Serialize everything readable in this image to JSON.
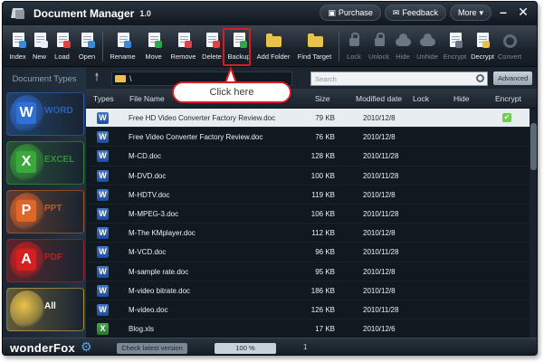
{
  "window": {
    "title": "Document Manager",
    "version": "1.0"
  },
  "title_buttons": {
    "purchase": "Purchase",
    "feedback": "Feedback",
    "more": "More"
  },
  "toolbar": [
    {
      "key": "index",
      "label": "Index",
      "icon": "index-icon",
      "enabled": true
    },
    {
      "key": "new",
      "label": "New",
      "icon": "new-document-icon",
      "enabled": true
    },
    {
      "key": "load",
      "label": "Load",
      "icon": "load-icon",
      "enabled": true
    },
    {
      "key": "open",
      "label": "Open",
      "icon": "open-icon",
      "enabled": true
    },
    {
      "key": "rename",
      "label": "Rename",
      "icon": "rename-icon",
      "enabled": true
    },
    {
      "key": "move",
      "label": "Move",
      "icon": "move-icon",
      "enabled": true
    },
    {
      "key": "remove",
      "label": "Remove",
      "icon": "remove-icon",
      "enabled": true
    },
    {
      "key": "delete",
      "label": "Delete",
      "icon": "delete-icon",
      "enabled": true
    },
    {
      "key": "backup",
      "label": "Backup",
      "icon": "backup-icon",
      "enabled": true
    },
    {
      "key": "add_folder",
      "label": "Add Folder",
      "icon": "add-folder-icon",
      "enabled": true
    },
    {
      "key": "find_target",
      "label": "Find Target",
      "icon": "find-target-icon",
      "enabled": true
    },
    {
      "key": "lock",
      "label": "Lock",
      "icon": "lock-icon",
      "enabled": false
    },
    {
      "key": "unlock",
      "label": "Unlock",
      "icon": "unlock-icon",
      "enabled": false
    },
    {
      "key": "hide",
      "label": "Hide",
      "icon": "hide-icon",
      "enabled": false
    },
    {
      "key": "unhide",
      "label": "Unhide",
      "icon": "unhide-icon",
      "enabled": false
    },
    {
      "key": "encrypt",
      "label": "Encrypt",
      "icon": "encrypt-icon",
      "enabled": false
    },
    {
      "key": "decrypt",
      "label": "Decrypt",
      "icon": "decrypt-icon",
      "enabled": true
    },
    {
      "key": "convert",
      "label": "Convert",
      "icon": "convert-icon",
      "enabled": false
    }
  ],
  "sidebar": {
    "title": "Document Types",
    "categories": [
      {
        "label": "WORD",
        "letter": "W",
        "color": "#2f6fd6"
      },
      {
        "label": "EXCEL",
        "letter": "X",
        "color": "#3aa83a"
      },
      {
        "label": "PPT",
        "letter": "P",
        "color": "#e0662a"
      },
      {
        "label": "PDF",
        "letter": "A",
        "color": "#d42020"
      },
      {
        "label": "All",
        "letter": "",
        "color": "#e8c24a"
      }
    ]
  },
  "pathbar": {
    "path": "\\",
    "search_placeholder": "Search",
    "advanced_label": "Advanced"
  },
  "columns": {
    "types": "Types",
    "file_name": "File Name",
    "size": "Size",
    "modified": "Modified date",
    "lock": "Lock",
    "hide": "Hide",
    "encrypt": "Encrypt"
  },
  "files": [
    {
      "type": "doc",
      "name": "Free HD Video Converter Factory Review.doc",
      "size": "79 KB",
      "modified": "2010/12/8",
      "encrypted": true,
      "selected": true
    },
    {
      "type": "doc",
      "name": "Free Video Converter Factory Review.doc",
      "size": "76 KB",
      "modified": "2010/12/8",
      "encrypted": false,
      "selected": false
    },
    {
      "type": "doc",
      "name": "M-CD.doc",
      "size": "128 KB",
      "modified": "2010/11/28",
      "encrypted": false,
      "selected": false
    },
    {
      "type": "doc",
      "name": "M-DVD.doc",
      "size": "100 KB",
      "modified": "2010/11/28",
      "encrypted": false,
      "selected": false
    },
    {
      "type": "doc",
      "name": "M-HDTV.doc",
      "size": "119 KB",
      "modified": "2010/12/8",
      "encrypted": false,
      "selected": false
    },
    {
      "type": "doc",
      "name": "M-MPEG-3.doc",
      "size": "106 KB",
      "modified": "2010/11/28",
      "encrypted": false,
      "selected": false
    },
    {
      "type": "doc",
      "name": "M-The KMplayer.doc",
      "size": "112 KB",
      "modified": "2010/12/8",
      "encrypted": false,
      "selected": false
    },
    {
      "type": "doc",
      "name": "M-VCD.doc",
      "size": "96 KB",
      "modified": "2010/11/28",
      "encrypted": false,
      "selected": false
    },
    {
      "type": "doc",
      "name": "M-sample rate.doc",
      "size": "95 KB",
      "modified": "2010/12/8",
      "encrypted": false,
      "selected": false
    },
    {
      "type": "doc",
      "name": "M-video bitrate.doc",
      "size": "186 KB",
      "modified": "2010/12/8",
      "encrypted": false,
      "selected": false
    },
    {
      "type": "doc",
      "name": "M-video.doc",
      "size": "126 KB",
      "modified": "2010/11/28",
      "encrypted": false,
      "selected": false
    },
    {
      "type": "xls",
      "name": "Blog.xls",
      "size": "17 KB",
      "modified": "2010/12/6",
      "encrypted": false,
      "selected": false
    }
  ],
  "statusbar": {
    "brand": "wonderFox",
    "check_version": "Check latest version",
    "progress_text": "100 %",
    "progress": 1.0,
    "page": "1"
  },
  "callout": {
    "text": "Click here"
  }
}
